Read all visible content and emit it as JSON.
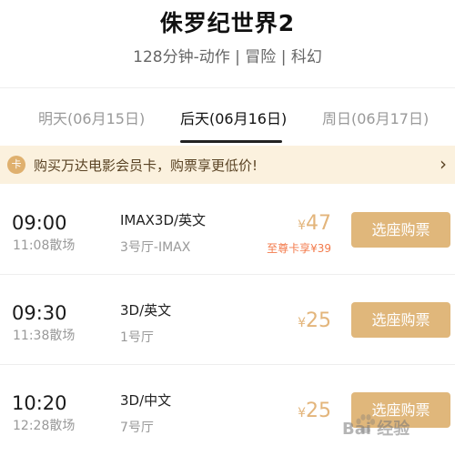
{
  "movie": {
    "title": "侏罗纪世界2",
    "subtitle": "128分钟-动作 | 冒险 | 科幻"
  },
  "date_tabs": [
    {
      "label": "明天(06月15日)",
      "active": false
    },
    {
      "label": "后天(06月16日)",
      "active": true
    },
    {
      "label": "周日(06月17日)",
      "active": false
    }
  ],
  "promo": {
    "badge": "卡",
    "text": "购买万达电影会员卡，购票享更低价!",
    "chevron": "›"
  },
  "showtimes": [
    {
      "start": "09:00",
      "end": "11:08散场",
      "format": "IMAX3D/英文",
      "hall": "3号厅-IMAX",
      "currency": "¥",
      "price": "47",
      "member_price": "至尊卡享¥39",
      "button": "选座购票"
    },
    {
      "start": "09:30",
      "end": "11:38散场",
      "format": "3D/英文",
      "hall": "1号厅",
      "currency": "¥",
      "price": "25",
      "member_price": "",
      "button": "选座购票"
    },
    {
      "start": "10:20",
      "end": "12:28散场",
      "format": "3D/中文",
      "hall": "7号厅",
      "currency": "¥",
      "price": "25",
      "member_price": "",
      "button": "选座购票"
    }
  ],
  "watermark": {
    "text": "Bai 经验"
  },
  "colors": {
    "accent": "#e0b77b",
    "promo_bg": "#fbf1de",
    "member_price": "#f37a4b"
  },
  "icons": {
    "promo_arrow": "chevron-right-icon",
    "watermark": "baidu-paw-icon"
  }
}
